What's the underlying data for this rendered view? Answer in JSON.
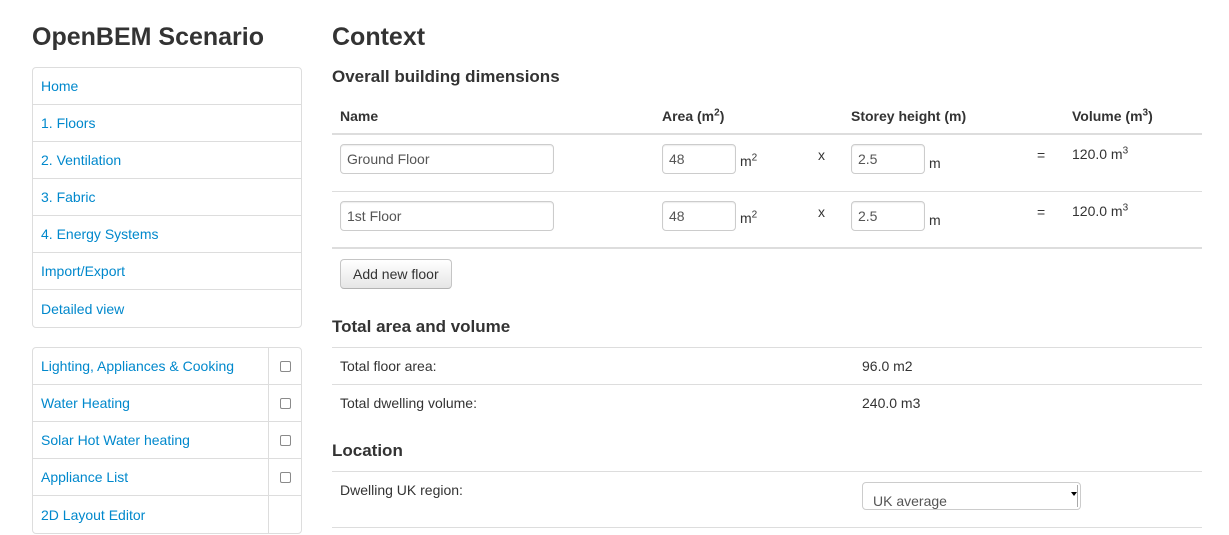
{
  "app": {
    "title": "OpenBEM Scenario"
  },
  "nav": {
    "items": [
      {
        "label": "Home"
      },
      {
        "label": "1. Floors"
      },
      {
        "label": "2. Ventilation"
      },
      {
        "label": "3. Fabric"
      },
      {
        "label": "4. Energy Systems"
      },
      {
        "label": "Import/Export"
      },
      {
        "label": "Detailed view"
      }
    ]
  },
  "modules": {
    "items": [
      {
        "label": "Lighting, Appliances & Cooking",
        "checked": false
      },
      {
        "label": "Water Heating",
        "checked": false
      },
      {
        "label": "Solar Hot Water heating",
        "checked": false
      },
      {
        "label": "Appliance List",
        "checked": false
      },
      {
        "label": "2D Layout Editor"
      }
    ]
  },
  "page": {
    "title": "Context"
  },
  "dimensions": {
    "title": "Overall building dimensions",
    "headers": {
      "name": "Name",
      "area": "Area (m",
      "height": "Storey height (m)",
      "volume": "Volume (m"
    },
    "sup": "2",
    "sup_vol": "3",
    "floors": [
      {
        "name": "Ground Floor",
        "area": "48",
        "area_unit": "m",
        "op_x": "x",
        "height": "2.5",
        "height_unit": "m",
        "op_eq": "=",
        "volume": "120.0 m"
      },
      {
        "name": "1st Floor",
        "area": "48",
        "area_unit": "m",
        "op_x": "x",
        "height": "2.5",
        "height_unit": "m",
        "op_eq": "=",
        "volume": "120.0 m"
      }
    ],
    "add_button": "Add new floor"
  },
  "totals": {
    "title": "Total area and volume",
    "floor_area_label": "Total floor area:",
    "floor_area_value": "96.0 m2",
    "volume_label": "Total dwelling volume:",
    "volume_value": "240.0 m3"
  },
  "location": {
    "title": "Location",
    "region_label": "Dwelling UK region:",
    "region_selected": "UK average"
  }
}
